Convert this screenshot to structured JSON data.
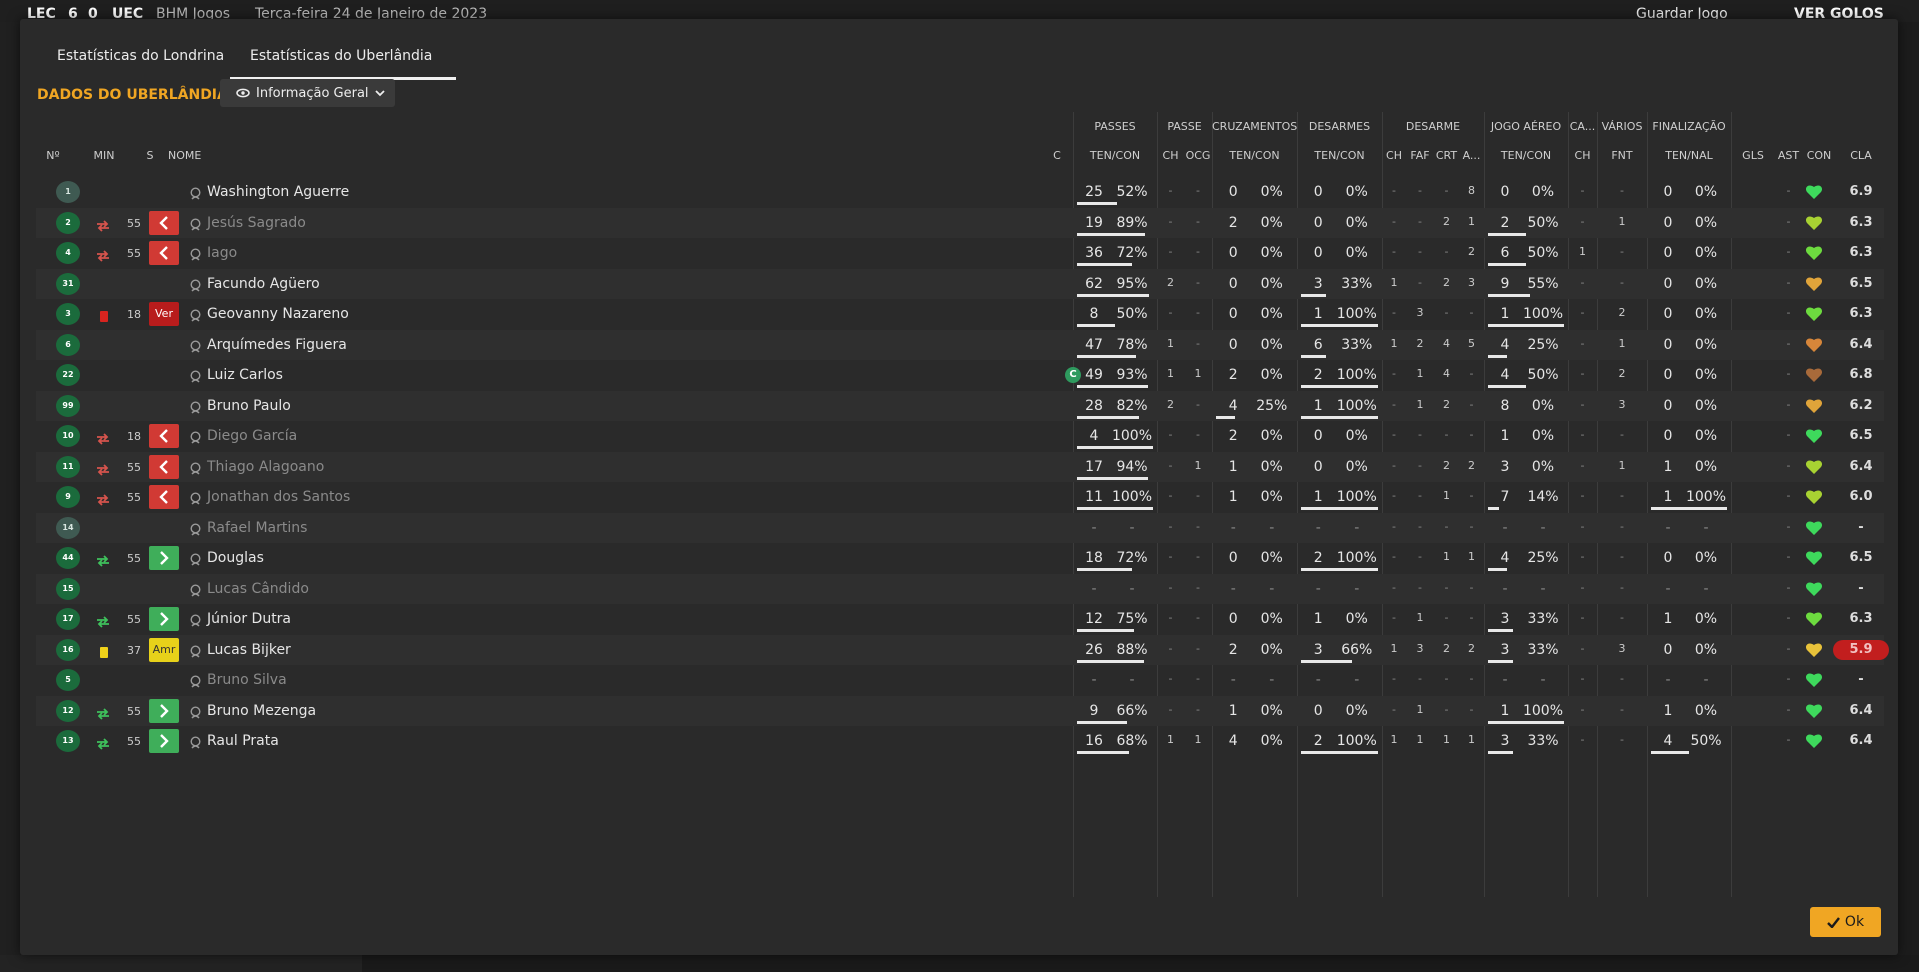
{
  "topbar": {
    "home_team": "LEC",
    "score_home": "6",
    "score_away": "0",
    "away_team": "UEC",
    "league": "BHM Jogos",
    "date": "Terça-feira 24 de Janeiro de 2023",
    "save_button": "Guardar Jogo",
    "goals_button": "VER GOLOS"
  },
  "tabs": [
    {
      "label": "Estatísticas do Londrina"
    },
    {
      "label": "Estatísticas do Uberlândia"
    }
  ],
  "section_title": "DADOS DO UBERLÂNDIA",
  "view_dropdown": {
    "label": "Informação Geral"
  },
  "group_headers": {
    "passes": "PASSES",
    "passe": "PASSE",
    "cruzamentos": "CRUZAMENTOS",
    "desarmes": "DESARMES",
    "desarme": "DESARME",
    "jogo_aereo": "JOGO AÉREO",
    "ca": "CA...",
    "varios": "VÁRIOS",
    "finalizacao": "FINALIZAÇÃO"
  },
  "column_headers": {
    "no": "Nº",
    "min": "MIN",
    "s": "S",
    "nome": "NOME",
    "c": "C",
    "passes_tc": "TEN/CON",
    "passe_ch": "CH",
    "passe_ocg": "OCG",
    "cruz_tc": "TEN/CON",
    "des_tc": "TEN/CON",
    "d_ch": "CH",
    "d_faf": "FAF",
    "d_crt": "CRT",
    "d_a": "A...",
    "aer_tc": "TEN/CON",
    "ca_ch": "CH",
    "var_fnt": "FNT",
    "fin_tn": "TEN/NAL",
    "gls": "GLS",
    "ast": "AST",
    "con": "CON",
    "cla": "CLA"
  },
  "rows": [
    {
      "no": "1",
      "gk": true,
      "name": "Washington Aguerre",
      "p_t": "25",
      "p_c": "52%",
      "pc_ch": "-",
      "pc_ocg": "-",
      "cr_t": "0",
      "cr_c": "0%",
      "de_t": "0",
      "de_c": "0%",
      "ch": "-",
      "faf": "-",
      "crt": "-",
      "a": "8",
      "ae_t": "0",
      "ae_c": "0%",
      "ca": "-",
      "fnt": "-",
      "fi_t": "0",
      "fi_c": "0%",
      "gls": "",
      "ast": "-",
      "rating": "6.9",
      "heart": "#3ed95c"
    },
    {
      "no": "2",
      "name": "Jesús Sagrado",
      "dim": true,
      "min": "55",
      "ev": "subout",
      "s": "out",
      "p_t": "19",
      "p_c": "89%",
      "pc_ch": "-",
      "pc_ocg": "-",
      "cr_t": "2",
      "cr_c": "0%",
      "de_t": "0",
      "de_c": "0%",
      "ch": "-",
      "faf": "-",
      "crt": "2",
      "a": "1",
      "ae_t": "2",
      "ae_c": "50%",
      "ca": "-",
      "fnt": "1",
      "fi_t": "0",
      "fi_c": "0%",
      "gls": "",
      "ast": "-",
      "rating": "6.3",
      "heart": "#a8d232"
    },
    {
      "no": "4",
      "name": "Iago",
      "dim": true,
      "min": "55",
      "ev": "subout",
      "s": "out",
      "p_t": "36",
      "p_c": "72%",
      "pc_ch": "-",
      "pc_ocg": "-",
      "cr_t": "0",
      "cr_c": "0%",
      "de_t": "0",
      "de_c": "0%",
      "ch": "-",
      "faf": "-",
      "crt": "-",
      "a": "2",
      "ae_t": "6",
      "ae_c": "50%",
      "ca": "1",
      "fnt": "-",
      "fi_t": "0",
      "fi_c": "0%",
      "gls": "",
      "ast": "-",
      "rating": "6.3",
      "heart": "#6ddb3f"
    },
    {
      "no": "31",
      "name": "Facundo Agüero",
      "p_t": "62",
      "p_c": "95%",
      "pc_ch": "2",
      "pc_ocg": "-",
      "cr_t": "0",
      "cr_c": "0%",
      "de_t": "3",
      "de_c": "33%",
      "ch": "1",
      "faf": "-",
      "crt": "2",
      "a": "3",
      "ae_t": "9",
      "ae_c": "55%",
      "ca": "-",
      "fnt": "-",
      "fi_t": "0",
      "fi_c": "0%",
      "gls": "",
      "ast": "-",
      "rating": "6.5",
      "heart": "#e0a43a"
    },
    {
      "no": "3",
      "name": "Geovanny Nazareno",
      "min": "18",
      "ev": "red",
      "s": "red",
      "s_label": "Ver",
      "p_t": "8",
      "p_c": "50%",
      "pc_ch": "-",
      "pc_ocg": "-",
      "cr_t": "0",
      "cr_c": "0%",
      "de_t": "1",
      "de_c": "100%",
      "ch": "-",
      "faf": "3",
      "crt": "-",
      "a": "-",
      "ae_t": "1",
      "ae_c": "100%",
      "ca": "-",
      "fnt": "2",
      "fi_t": "0",
      "fi_c": "0%",
      "gls": "",
      "ast": "-",
      "rating": "6.3",
      "heart": "#6ddb3f"
    },
    {
      "no": "6",
      "name": "Arquímedes Figuera",
      "p_t": "47",
      "p_c": "78%",
      "pc_ch": "1",
      "pc_ocg": "-",
      "cr_t": "0",
      "cr_c": "0%",
      "de_t": "6",
      "de_c": "33%",
      "ch": "1",
      "faf": "2",
      "crt": "4",
      "a": "5",
      "ae_t": "4",
      "ae_c": "25%",
      "ca": "-",
      "fnt": "1",
      "fi_t": "0",
      "fi_c": "0%",
      "gls": "",
      "ast": "-",
      "rating": "6.4",
      "heart": "#d6863a"
    },
    {
      "no": "22",
      "name": "Luiz Carlos",
      "captain": "C",
      "p_t": "49",
      "p_c": "93%",
      "pc_ch": "1",
      "pc_ocg": "1",
      "cr_t": "2",
      "cr_c": "0%",
      "de_t": "2",
      "de_c": "100%",
      "ch": "-",
      "faf": "1",
      "crt": "4",
      "a": "-",
      "ae_t": "4",
      "ae_c": "50%",
      "ca": "-",
      "fnt": "2",
      "fi_t": "0",
      "fi_c": "0%",
      "gls": "",
      "ast": "-",
      "rating": "6.8",
      "heart": "#a86a3a"
    },
    {
      "no": "99",
      "name": "Bruno Paulo",
      "p_t": "28",
      "p_c": "82%",
      "pc_ch": "2",
      "pc_ocg": "-",
      "cr_t": "4",
      "cr_c": "25%",
      "de_t": "1",
      "de_c": "100%",
      "ch": "-",
      "faf": "1",
      "crt": "2",
      "a": "-",
      "ae_t": "8",
      "ae_c": "0%",
      "ca": "-",
      "fnt": "3",
      "fi_t": "0",
      "fi_c": "0%",
      "gls": "",
      "ast": "-",
      "rating": "6.2",
      "heart": "#e0a43a"
    },
    {
      "no": "10",
      "name": "Diego García",
      "dim": true,
      "min": "18",
      "ev": "subout",
      "s": "out",
      "p_t": "4",
      "p_c": "100%",
      "pc_ch": "-",
      "pc_ocg": "-",
      "cr_t": "2",
      "cr_c": "0%",
      "de_t": "0",
      "de_c": "0%",
      "ch": "-",
      "faf": "-",
      "crt": "-",
      "a": "-",
      "ae_t": "1",
      "ae_c": "0%",
      "ca": "-",
      "fnt": "-",
      "fi_t": "0",
      "fi_c": "0%",
      "gls": "",
      "ast": "-",
      "rating": "6.5",
      "heart": "#3ed95c"
    },
    {
      "no": "11",
      "name": "Thiago Alagoano",
      "dim": true,
      "min": "55",
      "ev": "subout",
      "s": "out",
      "p_t": "17",
      "p_c": "94%",
      "pc_ch": "-",
      "pc_ocg": "1",
      "cr_t": "1",
      "cr_c": "0%",
      "de_t": "0",
      "de_c": "0%",
      "ch": "-",
      "faf": "-",
      "crt": "2",
      "a": "2",
      "ae_t": "3",
      "ae_c": "0%",
      "ca": "-",
      "fnt": "1",
      "fi_t": "1",
      "fi_c": "0%",
      "gls": "",
      "ast": "-",
      "rating": "6.4",
      "heart": "#a8d232"
    },
    {
      "no": "9",
      "name": "Jonathan dos Santos",
      "dim": true,
      "min": "55",
      "ev": "subout",
      "s": "out",
      "p_t": "11",
      "p_c": "100%",
      "pc_ch": "-",
      "pc_ocg": "-",
      "cr_t": "1",
      "cr_c": "0%",
      "de_t": "1",
      "de_c": "100%",
      "ch": "-",
      "faf": "-",
      "crt": "1",
      "a": "-",
      "ae_t": "7",
      "ae_c": "14%",
      "ca": "-",
      "fnt": "-",
      "fi_t": "1",
      "fi_c": "100%",
      "gls": "",
      "ast": "-",
      "rating": "6.0",
      "heart": "#a8d232"
    },
    {
      "no": "14",
      "gk": true,
      "name": "Rafael Martins",
      "dim": true,
      "p_t": "-",
      "p_c": "-",
      "pc_ch": "-",
      "pc_ocg": "-",
      "cr_t": "-",
      "cr_c": "-",
      "de_t": "-",
      "de_c": "-",
      "ch": "-",
      "faf": "-",
      "crt": "-",
      "a": "-",
      "ae_t": "-",
      "ae_c": "-",
      "ca": "-",
      "fnt": "-",
      "fi_t": "-",
      "fi_c": "-",
      "gls": "",
      "ast": "-",
      "rating": "-",
      "heart": "#3ed95c"
    },
    {
      "no": "44",
      "name": "Douglas",
      "min": "55",
      "ev": "subin",
      "s": "in",
      "p_t": "18",
      "p_c": "72%",
      "pc_ch": "-",
      "pc_ocg": "-",
      "cr_t": "0",
      "cr_c": "0%",
      "de_t": "2",
      "de_c": "100%",
      "ch": "-",
      "faf": "-",
      "crt": "1",
      "a": "1",
      "ae_t": "4",
      "ae_c": "25%",
      "ca": "-",
      "fnt": "-",
      "fi_t": "0",
      "fi_c": "0%",
      "gls": "",
      "ast": "-",
      "rating": "6.5",
      "heart": "#3ed95c"
    },
    {
      "no": "15",
      "name": "Lucas Cândido",
      "dim": true,
      "p_t": "-",
      "p_c": "-",
      "pc_ch": "-",
      "pc_ocg": "-",
      "cr_t": "-",
      "cr_c": "-",
      "de_t": "-",
      "de_c": "-",
      "ch": "-",
      "faf": "-",
      "crt": "-",
      "a": "-",
      "ae_t": "-",
      "ae_c": "-",
      "ca": "-",
      "fnt": "-",
      "fi_t": "-",
      "fi_c": "-",
      "gls": "",
      "ast": "-",
      "rating": "-",
      "heart": "#3ed95c"
    },
    {
      "no": "17",
      "name": "Júnior Dutra",
      "min": "55",
      "ev": "subin",
      "s": "in",
      "p_t": "12",
      "p_c": "75%",
      "pc_ch": "-",
      "pc_ocg": "-",
      "cr_t": "0",
      "cr_c": "0%",
      "de_t": "1",
      "de_c": "0%",
      "ch": "-",
      "faf": "1",
      "crt": "-",
      "a": "-",
      "ae_t": "3",
      "ae_c": "33%",
      "ca": "-",
      "fnt": "-",
      "fi_t": "1",
      "fi_c": "0%",
      "gls": "",
      "ast": "-",
      "rating": "6.3",
      "heart": "#6ddb3f"
    },
    {
      "no": "16",
      "name": "Lucas Bijker",
      "min": "37",
      "ev": "yellow",
      "s": "yel",
      "s_label": "Amr",
      "p_t": "26",
      "p_c": "88%",
      "pc_ch": "-",
      "pc_ocg": "-",
      "cr_t": "2",
      "cr_c": "0%",
      "de_t": "3",
      "de_c": "66%",
      "ch": "1",
      "faf": "3",
      "crt": "2",
      "a": "2",
      "ae_t": "3",
      "ae_c": "33%",
      "ca": "-",
      "fnt": "3",
      "fi_t": "0",
      "fi_c": "0%",
      "gls": "",
      "ast": "-",
      "rating": "5.9",
      "low": true,
      "heart": "#e8c23a"
    },
    {
      "no": "5",
      "name": "Bruno Silva",
      "dim": true,
      "p_t": "-",
      "p_c": "-",
      "pc_ch": "-",
      "pc_ocg": "-",
      "cr_t": "-",
      "cr_c": "-",
      "de_t": "-",
      "de_c": "-",
      "ch": "-",
      "faf": "-",
      "crt": "-",
      "a": "-",
      "ae_t": "-",
      "ae_c": "-",
      "ca": "-",
      "fnt": "-",
      "fi_t": "-",
      "fi_c": "-",
      "gls": "",
      "ast": "-",
      "rating": "-",
      "heart": "#3ed95c"
    },
    {
      "no": "12",
      "name": "Bruno Mezenga",
      "min": "55",
      "ev": "subin",
      "s": "in",
      "p_t": "9",
      "p_c": "66%",
      "pc_ch": "-",
      "pc_ocg": "-",
      "cr_t": "1",
      "cr_c": "0%",
      "de_t": "0",
      "de_c": "0%",
      "ch": "-",
      "faf": "1",
      "crt": "-",
      "a": "-",
      "ae_t": "1",
      "ae_c": "100%",
      "ca": "-",
      "fnt": "-",
      "fi_t": "1",
      "fi_c": "0%",
      "gls": "",
      "ast": "-",
      "rating": "6.4",
      "heart": "#3ed95c"
    },
    {
      "no": "13",
      "name": "Raul Prata",
      "min": "55",
      "ev": "subin",
      "s": "in",
      "p_t": "16",
      "p_c": "68%",
      "pc_ch": "1",
      "pc_ocg": "1",
      "cr_t": "4",
      "cr_c": "0%",
      "de_t": "2",
      "de_c": "100%",
      "ch": "1",
      "faf": "1",
      "crt": "1",
      "a": "1",
      "ae_t": "3",
      "ae_c": "33%",
      "ca": "-",
      "fnt": "-",
      "fi_t": "4",
      "fi_c": "50%",
      "gls": "",
      "ast": "-",
      "rating": "6.4",
      "heart": "#3ed95c"
    }
  ],
  "ok_button": "Ok"
}
